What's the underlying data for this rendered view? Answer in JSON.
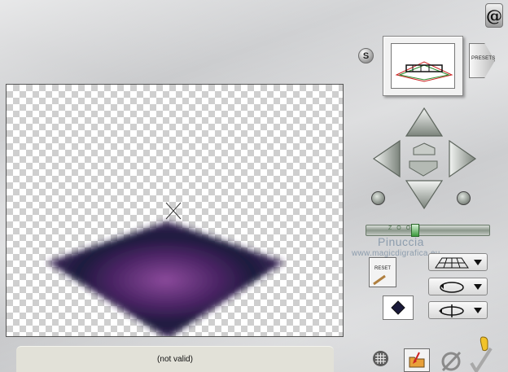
{
  "status": {
    "text": "(not valid)"
  },
  "buttons": {
    "s_label": "S",
    "presets_label": "PRESETS",
    "reset_label": "RESET",
    "about_label": "@"
  },
  "zoom": {
    "label": "ZOOM"
  },
  "watermark": {
    "name": "Pinuccia",
    "url": "www.magicdigrafica.eu"
  },
  "icons": {
    "about": "about-icon",
    "s": "snapshot-icon",
    "presets": "presets-icon",
    "up": "arrow-up-icon",
    "down": "arrow-down-icon",
    "left": "arrow-left-icon",
    "right": "arrow-right-icon",
    "move_up": "move-up-icon",
    "move_down": "move-down-icon",
    "rotate_left": "rotate-left-icon",
    "rotate_right": "rotate-right-icon",
    "reset": "reset-icon",
    "perspective": "perspective-grid-icon",
    "rotate": "rotate-loop-icon",
    "flip": "flip-icon",
    "mode": "diamond-swatch-icon",
    "grid": "grid-icon",
    "folder": "folder-icon",
    "cancel": "cancel-icon",
    "ok": "checkmark-icon"
  },
  "colors": {
    "shape_center": "#7a3b8c",
    "shape_edge": "#1a1a3a"
  }
}
